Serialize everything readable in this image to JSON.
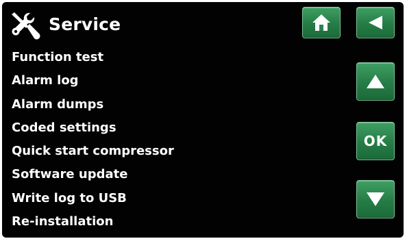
{
  "header": {
    "title": "Service",
    "icon": "tools-icon"
  },
  "buttons": {
    "home": {
      "icon": "home-icon"
    },
    "back": {
      "icon": "back-arrow-icon"
    },
    "up": {
      "icon": "arrow-up-icon"
    },
    "ok": {
      "label": "OK"
    },
    "down": {
      "icon": "arrow-down-icon"
    }
  },
  "menu": {
    "items": [
      {
        "label": "Function test"
      },
      {
        "label": "Alarm log"
      },
      {
        "label": "Alarm dumps"
      },
      {
        "label": "Coded settings"
      },
      {
        "label": "Quick start compressor"
      },
      {
        "label": "Software update"
      },
      {
        "label": "Write log to USB"
      },
      {
        "label": "Re-installation"
      }
    ]
  },
  "colors": {
    "background": "#020202",
    "button_green": "#257c46",
    "text": "#ffffff"
  }
}
